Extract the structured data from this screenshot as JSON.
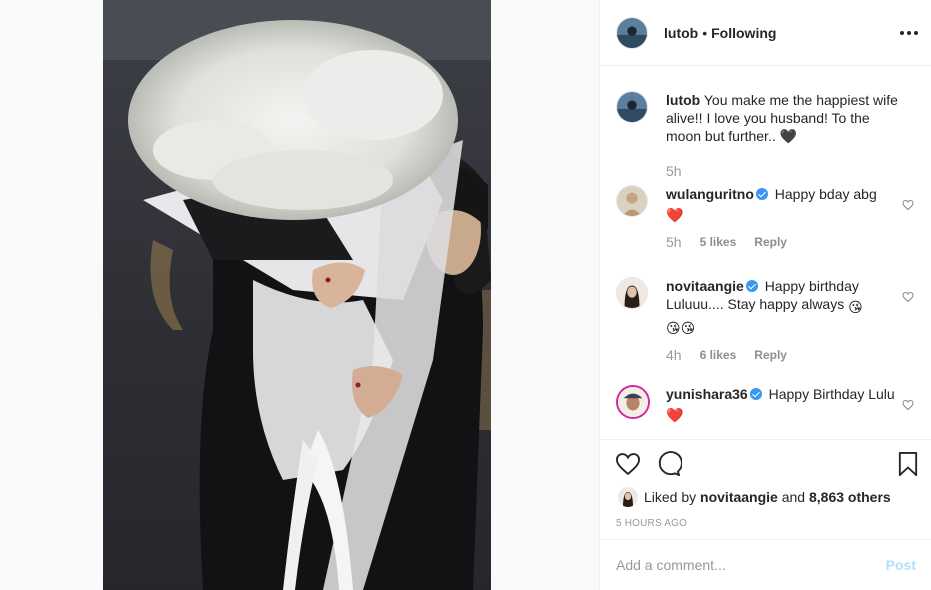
{
  "post": {
    "photo_alt": "",
    "header": {
      "username": "lutob",
      "separator": "•",
      "follow_status": "Following"
    },
    "caption": {
      "username": "lutob",
      "text": "You make me the happiest wife alive!! I love you husband! To the moon but further.. ",
      "heart_emoji": "🖤",
      "time": "5h"
    },
    "comments": [
      {
        "username": "wulanguritno",
        "verified": true,
        "text": "Happy bday abg",
        "emoji": "❤️",
        "time": "5h",
        "likes": "5 likes",
        "reply": "Reply"
      },
      {
        "username": "novitaangie",
        "verified": true,
        "text": "Happy birthday Luluuu.... Stay happy always ",
        "emoji": "😘",
        "emoji2": "😘😘",
        "time": "4h",
        "likes": "6 likes",
        "reply": "Reply"
      },
      {
        "username": "yunishara36",
        "verified": true,
        "text": "Happy Birthday Lulu",
        "emoji": "❤️"
      }
    ],
    "liked_by": {
      "prefix": "Liked by ",
      "user": "novitaangie",
      "middle": " and ",
      "others": "8,863 others"
    },
    "timestamp": "5 HOURS AGO",
    "add_comment_placeholder": "Add a comment...",
    "post_button": "Post"
  },
  "icons": {
    "more": "more-options-icon",
    "like": "heart-icon",
    "comment": "comment-icon",
    "save": "bookmark-icon",
    "comment_like": "heart-icon"
  },
  "colors": {
    "verified": "#3897f0",
    "post_button_disabled": "#b2dffc",
    "meta_text": "#8e8e8e"
  }
}
